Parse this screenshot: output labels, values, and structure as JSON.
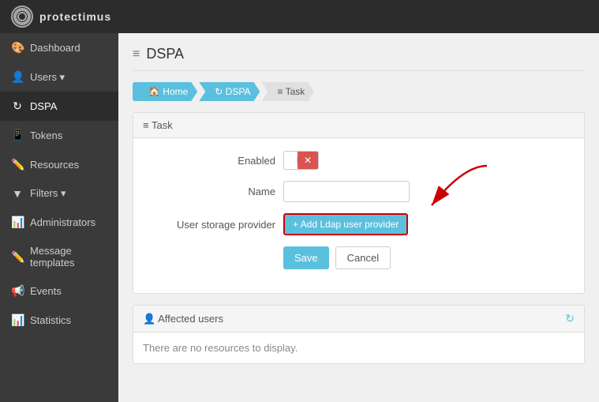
{
  "header": {
    "logo_text": "protectimus"
  },
  "sidebar": {
    "items": [
      {
        "id": "dashboard",
        "label": "Dashboard",
        "icon": "🎨"
      },
      {
        "id": "users",
        "label": "Users ▾",
        "icon": "👤"
      },
      {
        "id": "dspa",
        "label": "DSPA",
        "icon": "↻",
        "active": true
      },
      {
        "id": "tokens",
        "label": "Tokens",
        "icon": "📱"
      },
      {
        "id": "resources",
        "label": "Resources",
        "icon": "✏️"
      },
      {
        "id": "filters",
        "label": "Filters ▾",
        "icon": "▼"
      },
      {
        "id": "administrators",
        "label": "Administrators",
        "icon": "📊"
      },
      {
        "id": "message-templates",
        "label": "Message templates",
        "icon": "✏️"
      },
      {
        "id": "events",
        "label": "Events",
        "icon": "📢"
      },
      {
        "id": "statistics",
        "label": "Statistics",
        "icon": "📊"
      }
    ]
  },
  "page": {
    "title": "DSPA",
    "title_icon": "≡"
  },
  "breadcrumb": {
    "items": [
      {
        "id": "home",
        "label": "🏠 Home",
        "active": true
      },
      {
        "id": "dspa",
        "label": "↻ DSPA",
        "active": true
      },
      {
        "id": "task",
        "label": "≡ Task",
        "active": false
      }
    ]
  },
  "task_panel": {
    "header": "≡ Task",
    "fields": {
      "enabled_label": "Enabled",
      "name_label": "Name",
      "name_value": "",
      "provider_label": "User storage provider",
      "add_ldap_label": "+ Add Ldap user provider"
    },
    "buttons": {
      "save": "Save",
      "cancel": "Cancel"
    }
  },
  "affected_panel": {
    "header": "👤 Affected users",
    "no_resources_text": "There are no resources to display."
  }
}
